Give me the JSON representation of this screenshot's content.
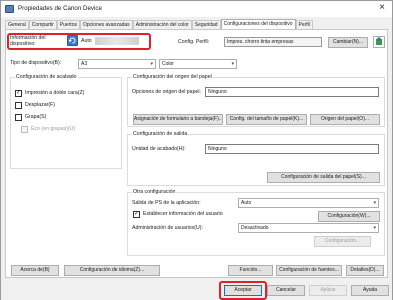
{
  "window": {
    "title": "Propiedades de Canon Device"
  },
  "tabs": [
    {
      "label": "General"
    },
    {
      "label": "Compartir"
    },
    {
      "label": "Puertos"
    },
    {
      "label": "Opciones avanzadas"
    },
    {
      "label": "Administración del color"
    },
    {
      "label": "Seguridad"
    },
    {
      "label": "Configuraciones del dispositivo"
    },
    {
      "label": "Perfil"
    }
  ],
  "device_info": {
    "label": "Información del dispositivo:",
    "mode": "Auto"
  },
  "profile": {
    "label": "Config. Perfil:",
    "value": "Impres. chorro tinta empresas",
    "change_button": "Cambiar(N)..."
  },
  "device_type": {
    "label": "Tipo de dispositivo(B):",
    "paper_size": "A3",
    "color_mode": "Color"
  },
  "finishing": {
    "legend": "Configuración de acabado",
    "options": [
      {
        "label": "Impresión a doble cara(Z)",
        "checked": true,
        "enabled": true
      },
      {
        "label": "Desplazar(F)",
        "checked": false,
        "enabled": true
      },
      {
        "label": "Grapa(S)",
        "checked": false,
        "enabled": true
      },
      {
        "label": "Eco (en grapas)(U)",
        "checked": false,
        "enabled": false
      }
    ]
  },
  "paper_source": {
    "legend": "Configuración del origen del papel",
    "options_label": "Opciones de origen del papel:",
    "options_value": "Ninguno",
    "buttons": [
      "Asignación de formulario a bandeja(F)...",
      "Config. del tamaño de papel(K)...",
      "Origen del papel(O)..."
    ]
  },
  "output": {
    "legend": "Configuración de salida",
    "finishing_unit_label": "Unidad de acabado(H):",
    "finishing_unit_value": "Ninguno",
    "button": "Configuración de salida del papel(S)..."
  },
  "other": {
    "legend": "Otra configuración",
    "ps_output_label": "Salida de PS de la aplicación:",
    "ps_output_value": "Auto",
    "user_info_label": "Establecer información del usuario",
    "user_info_checked": true,
    "config_button": "Configuración(W)...",
    "user_admin_label": "Administración de usuarios(U):",
    "user_admin_value": "Desactivado",
    "config_button_disabled": "Configuración..."
  },
  "bottom_buttons": {
    "about": "Acerca de(B)",
    "language": "Configuración de idioma(Z)...",
    "function": "Función...",
    "sources": "Configuración de fuentes...",
    "details": "Detalles(D)..."
  },
  "dialog_buttons": {
    "accept": "Aceptar",
    "cancel": "Cancelar",
    "apply": "Aplicar",
    "help": "Ayuda"
  },
  "icons": {
    "refresh": "refresh-icon",
    "profile": "profile-icon"
  },
  "colors": {
    "highlight_box": "#e0202a",
    "focus_border": "#0078d7"
  }
}
